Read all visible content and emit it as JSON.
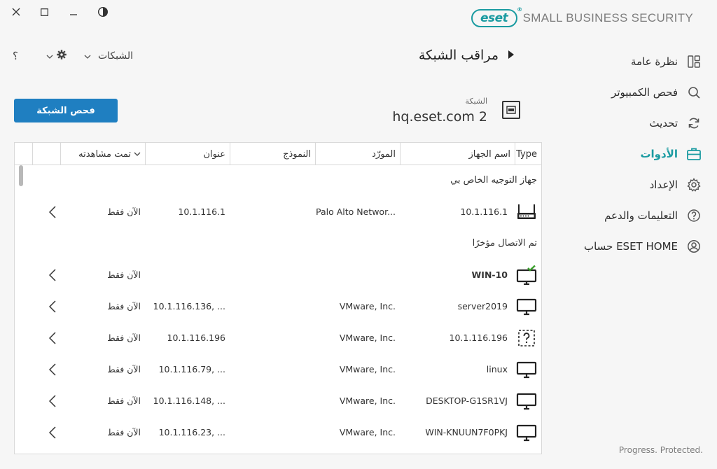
{
  "app": {
    "logo_mark": "eset",
    "product_name": "SMALL BUSINESS SECURITY",
    "footer": "Progress. Protected.",
    "accent_color": "#1a9ba1",
    "button_color": "#1f7fc1"
  },
  "window_controls": [
    "close-icon",
    "minimize-icon",
    "maximize-icon",
    "contrast-icon"
  ],
  "sidebar": {
    "items": [
      {
        "label": "نظرة عامة",
        "icon": "overview-icon",
        "active": false
      },
      {
        "label": "فحص الكمبيوتر",
        "icon": "search-icon",
        "active": false
      },
      {
        "label": "تحديث",
        "icon": "refresh-icon",
        "active": false
      },
      {
        "label": "الأدوات",
        "icon": "toolbox-icon",
        "active": true
      },
      {
        "label": "الإعداد",
        "icon": "gear-icon",
        "active": false
      },
      {
        "label": "التعليمات والدعم",
        "icon": "help-icon",
        "active": false
      },
      {
        "label": "ESET HOME حساب",
        "icon": "user-icon",
        "active": false
      }
    ]
  },
  "header": {
    "title": "مراقب الشبكة",
    "networks_label": "الشبكات",
    "help_symbol": "؟"
  },
  "network": {
    "label": "الشبكة",
    "name": "hq.eset.com 2",
    "scan_button": "فحص الشبكة"
  },
  "table": {
    "columns": {
      "type": "Type",
      "device_name": "اسم الجهاز",
      "vendor": "المورّد",
      "model": "النموذج",
      "address": "عنوان",
      "last_seen": "تمت مشاهدته"
    },
    "sections": [
      {
        "title": "جهاز التوجيه الخاص بي",
        "rows": [
          {
            "icon": "router-icon",
            "name": "10.1.116.1",
            "vendor": "Palo Alto Networ...",
            "address": "10.1.116.1",
            "last_seen": "الآن فقط",
            "bold": false
          }
        ]
      },
      {
        "title": "تم الاتصال مؤخرًا",
        "rows": [
          {
            "icon": "monitor-check-icon",
            "name": "WIN-10",
            "vendor": "",
            "address": "",
            "last_seen": "الآن فقط",
            "bold": true
          },
          {
            "icon": "monitor-icon",
            "name": "server2019",
            "vendor": "VMware, Inc.",
            "address": "10.1.116.136, ...",
            "last_seen": "الآن فقط",
            "bold": false
          },
          {
            "icon": "unknown-device-icon",
            "name": "10.1.116.196",
            "vendor": "VMware, Inc.",
            "address": "10.1.116.196",
            "last_seen": "الآن فقط",
            "bold": false
          },
          {
            "icon": "monitor-icon",
            "name": "linux",
            "vendor": "VMware, Inc.",
            "address": "10.1.116.79, ...",
            "last_seen": "الآن فقط",
            "bold": false
          },
          {
            "icon": "monitor-icon",
            "name": "DESKTOP-G1SR1VJ",
            "vendor": "VMware, Inc.",
            "address": "10.1.116.148, ...",
            "last_seen": "الآن فقط",
            "bold": false
          },
          {
            "icon": "monitor-icon",
            "name": "WIN-KNUUN7F0PKJ",
            "vendor": "VMware, Inc.",
            "address": "10.1.116.23, ...",
            "last_seen": "الآن فقط",
            "bold": false
          }
        ]
      }
    ]
  }
}
